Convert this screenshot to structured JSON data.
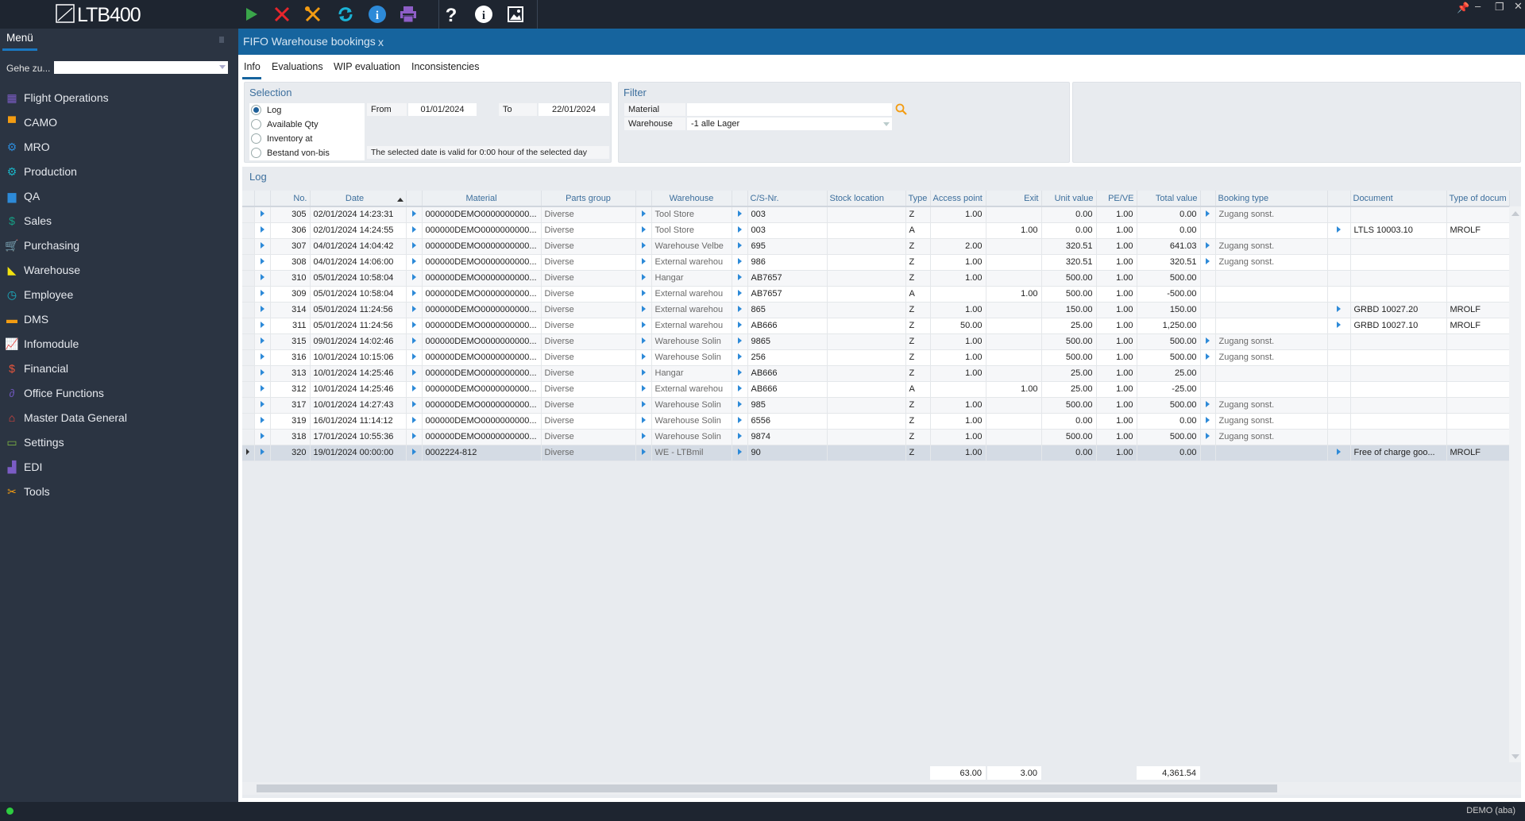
{
  "app": {
    "logo": "LTB400",
    "status_user": "DEMO (aba)",
    "status_color": "#2ecc40",
    "accent": "#16649e"
  },
  "toolbar": [
    {
      "icon": "play-icon",
      "color": "#3aa64a"
    },
    {
      "icon": "tools-cross-red-icon",
      "color": "#e8262c"
    },
    {
      "icon": "tools-orange-icon",
      "color": "#f39c12"
    },
    {
      "icon": "refresh-icon",
      "color": "#1ab3d6"
    },
    {
      "icon": "info-circle-icon",
      "color": "#2d8ad8"
    },
    {
      "icon": "printer-icon",
      "color": "#8e5ec7"
    },
    {
      "icon": "help-icon",
      "color": "#ffffff"
    },
    {
      "icon": "info-icon",
      "color": "#ffffff"
    },
    {
      "icon": "image-icon",
      "color": "#ffffff"
    }
  ],
  "sidebar": {
    "title": "Menü",
    "goto_label": "Gehe zu...",
    "goto_value": "",
    "items": [
      {
        "label": "Flight Operations",
        "icon": "calendar-icon",
        "color": "#7b5cc4"
      },
      {
        "label": "CAMO",
        "icon": "camo-icon",
        "color": "#f39c12"
      },
      {
        "label": "MRO",
        "icon": "gear-icon",
        "color": "#2d8ad8"
      },
      {
        "label": "Production",
        "icon": "gears-icon",
        "color": "#1ab3c6"
      },
      {
        "label": "QA",
        "icon": "folder-doc-icon",
        "color": "#2d8ad8"
      },
      {
        "label": "Sales",
        "icon": "dollar-icon",
        "color": "#16a085"
      },
      {
        "label": "Purchasing",
        "icon": "cart-icon",
        "color": "#9b59b6"
      },
      {
        "label": "Warehouse",
        "icon": "hand-truck-icon",
        "color": "#f1e20f"
      },
      {
        "label": "Employee",
        "icon": "clock-icon",
        "color": "#1ab3c6"
      },
      {
        "label": "DMS",
        "icon": "folder-icon",
        "color": "#f39c12"
      },
      {
        "label": "Infomodule",
        "icon": "chart-icon",
        "color": "#2d8ad8"
      },
      {
        "label": "Financial",
        "icon": "money-icon",
        "color": "#e8553c"
      },
      {
        "label": "Office Functions",
        "icon": "paperclip-icon",
        "color": "#6b55b5"
      },
      {
        "label": "Master Data General",
        "icon": "home-icon",
        "color": "#e8453c"
      },
      {
        "label": "Settings",
        "icon": "monitor-icon",
        "color": "#7cb342"
      },
      {
        "label": "EDI",
        "icon": "factory-icon",
        "color": "#7b5cc4"
      },
      {
        "label": "Tools",
        "icon": "tools-icon",
        "color": "#f39c12"
      }
    ]
  },
  "tab": {
    "title": "FIFO Warehouse bookings",
    "close": "x"
  },
  "subtabs": [
    "Info",
    "Evaluations",
    "WIP evaluation",
    "Inconsistencies"
  ],
  "selection": {
    "title": "Selection",
    "options": [
      {
        "label": "Log",
        "selected": true
      },
      {
        "label": "Available Qty",
        "selected": false
      },
      {
        "label": "Inventory at",
        "selected": false
      },
      {
        "label": "Bestand von-bis",
        "selected": false
      }
    ],
    "from_label": "From",
    "from_value": "01/01/2024",
    "to_label": "To",
    "to_value": "22/01/2024",
    "note": "The selected date is valid for 0:00 hour of the selected day"
  },
  "filter": {
    "title": "Filter",
    "material_label": "Material",
    "material_value": "",
    "warehouse_label": "Warehouse",
    "warehouse_value": "-1  alle Lager"
  },
  "log": {
    "title": "Log",
    "columns": [
      "No.",
      "Date",
      "Material",
      "Parts group",
      "Warehouse",
      "C/S-Nr.",
      "Stock location",
      "Type",
      "Access point",
      "Exit",
      "Unit value",
      "PE/VE",
      "Total value",
      "Booking type",
      "Document",
      "Type of docum"
    ],
    "sort": {
      "column": "Date",
      "direction": "ascending"
    },
    "rows": [
      {
        "no": "305",
        "date": "02/01/2024 14:23:31",
        "material": "000000DEMO0000000000...",
        "parts": "Diverse",
        "wh": "Tool Store",
        "cs": "003",
        "loc": "",
        "type": "Z",
        "access": "1.00",
        "exit": "",
        "unit": "0.00",
        "pe": "1.00",
        "total": "0.00",
        "booking": "Zugang sonst.",
        "doc": "",
        "doctype": ""
      },
      {
        "no": "306",
        "date": "02/01/2024 14:24:55",
        "material": "000000DEMO0000000000...",
        "parts": "Diverse",
        "wh": "Tool Store",
        "cs": "003",
        "loc": "",
        "type": "A",
        "access": "",
        "exit": "1.00",
        "unit": "0.00",
        "pe": "1.00",
        "total": "0.00",
        "booking": "",
        "doc": "LTLS  10003.10",
        "doctype": "MROLF"
      },
      {
        "no": "307",
        "date": "04/01/2024 14:04:42",
        "material": "000000DEMO0000000000...",
        "parts": "Diverse",
        "wh": "Warehouse Velbe",
        "cs": "695",
        "loc": "",
        "type": "Z",
        "access": "2.00",
        "exit": "",
        "unit": "320.51",
        "pe": "1.00",
        "total": "641.03",
        "booking": "Zugang sonst.",
        "doc": "",
        "doctype": ""
      },
      {
        "no": "308",
        "date": "04/01/2024 14:06:00",
        "material": "000000DEMO0000000000...",
        "parts": "Diverse",
        "wh": "External warehou",
        "cs": "986",
        "loc": "",
        "type": "Z",
        "access": "1.00",
        "exit": "",
        "unit": "320.51",
        "pe": "1.00",
        "total": "320.51",
        "booking": "Zugang sonst.",
        "doc": "",
        "doctype": ""
      },
      {
        "no": "310",
        "date": "05/01/2024 10:58:04",
        "material": "000000DEMO0000000000...",
        "parts": "Diverse",
        "wh": "Hangar",
        "cs": "AB7657",
        "loc": "",
        "type": "Z",
        "access": "1.00",
        "exit": "",
        "unit": "500.00",
        "pe": "1.00",
        "total": "500.00",
        "booking": "",
        "doc": "",
        "doctype": ""
      },
      {
        "no": "309",
        "date": "05/01/2024 10:58:04",
        "material": "000000DEMO0000000000...",
        "parts": "Diverse",
        "wh": "External warehou",
        "cs": "AB7657",
        "loc": "",
        "type": "A",
        "access": "",
        "exit": "1.00",
        "unit": "500.00",
        "pe": "1.00",
        "total": "-500.00",
        "booking": "",
        "doc": "",
        "doctype": ""
      },
      {
        "no": "314",
        "date": "05/01/2024 11:24:56",
        "material": "000000DEMO0000000000...",
        "parts": "Diverse",
        "wh": "External warehou",
        "cs": "865",
        "loc": "",
        "type": "Z",
        "access": "1.00",
        "exit": "",
        "unit": "150.00",
        "pe": "1.00",
        "total": "150.00",
        "booking": "",
        "doc": "GRBD 10027.20",
        "doctype": "MROLF"
      },
      {
        "no": "311",
        "date": "05/01/2024 11:24:56",
        "material": "000000DEMO0000000000...",
        "parts": "Diverse",
        "wh": "External warehou",
        "cs": "AB666",
        "loc": "",
        "type": "Z",
        "access": "50.00",
        "exit": "",
        "unit": "25.00",
        "pe": "1.00",
        "total": "1,250.00",
        "booking": "",
        "doc": "GRBD 10027.10",
        "doctype": "MROLF"
      },
      {
        "no": "315",
        "date": "09/01/2024 14:02:46",
        "material": "000000DEMO0000000000...",
        "parts": "Diverse",
        "wh": "Warehouse Solin",
        "cs": "9865",
        "loc": "",
        "type": "Z",
        "access": "1.00",
        "exit": "",
        "unit": "500.00",
        "pe": "1.00",
        "total": "500.00",
        "booking": "Zugang sonst.",
        "doc": "",
        "doctype": ""
      },
      {
        "no": "316",
        "date": "10/01/2024 10:15:06",
        "material": "000000DEMO0000000000...",
        "parts": "Diverse",
        "wh": "Warehouse Solin",
        "cs": "256",
        "loc": "",
        "type": "Z",
        "access": "1.00",
        "exit": "",
        "unit": "500.00",
        "pe": "1.00",
        "total": "500.00",
        "booking": "Zugang sonst.",
        "doc": "",
        "doctype": ""
      },
      {
        "no": "313",
        "date": "10/01/2024 14:25:46",
        "material": "000000DEMO0000000000...",
        "parts": "Diverse",
        "wh": "Hangar",
        "cs": "AB666",
        "loc": "",
        "type": "Z",
        "access": "1.00",
        "exit": "",
        "unit": "25.00",
        "pe": "1.00",
        "total": "25.00",
        "booking": "",
        "doc": "",
        "doctype": ""
      },
      {
        "no": "312",
        "date": "10/01/2024 14:25:46",
        "material": "000000DEMO0000000000...",
        "parts": "Diverse",
        "wh": "External warehou",
        "cs": "AB666",
        "loc": "",
        "type": "A",
        "access": "",
        "exit": "1.00",
        "unit": "25.00",
        "pe": "1.00",
        "total": "-25.00",
        "booking": "",
        "doc": "",
        "doctype": ""
      },
      {
        "no": "317",
        "date": "10/01/2024 14:27:43",
        "material": "000000DEMO0000000000...",
        "parts": "Diverse",
        "wh": "Warehouse Solin",
        "cs": "985",
        "loc": "",
        "type": "Z",
        "access": "1.00",
        "exit": "",
        "unit": "500.00",
        "pe": "1.00",
        "total": "500.00",
        "booking": "Zugang sonst.",
        "doc": "",
        "doctype": ""
      },
      {
        "no": "319",
        "date": "16/01/2024 11:14:12",
        "material": "000000DEMO0000000000...",
        "parts": "Diverse",
        "wh": "Warehouse Solin",
        "cs": "6556",
        "loc": "",
        "type": "Z",
        "access": "1.00",
        "exit": "",
        "unit": "0.00",
        "pe": "1.00",
        "total": "0.00",
        "booking": "Zugang sonst.",
        "doc": "",
        "doctype": ""
      },
      {
        "no": "318",
        "date": "17/01/2024 10:55:36",
        "material": "000000DEMO0000000000...",
        "parts": "Diverse",
        "wh": "Warehouse Solin",
        "cs": "9874",
        "loc": "",
        "type": "Z",
        "access": "1.00",
        "exit": "",
        "unit": "500.00",
        "pe": "1.00",
        "total": "500.00",
        "booking": "Zugang sonst.",
        "doc": "",
        "doctype": ""
      },
      {
        "no": "320",
        "date": "19/01/2024 00:00:00",
        "material": "0002224-812",
        "parts": "Diverse",
        "wh": "WE - LTBmil",
        "cs": "90",
        "loc": "",
        "type": "Z",
        "access": "1.00",
        "exit": "",
        "unit": "0.00",
        "pe": "1.00",
        "total": "0.00",
        "booking": "",
        "doc": "Free of charge goo...",
        "doctype": "MROLF",
        "selected": true
      }
    ],
    "totals": {
      "access": "63.00",
      "exit": "3.00",
      "total": "4,361.54"
    }
  }
}
